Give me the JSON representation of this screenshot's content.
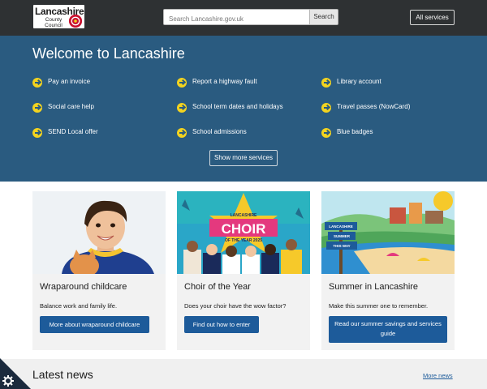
{
  "header": {
    "logo_title": "Lancashire",
    "logo_subtitle": "County Council",
    "search_placeholder": "Search Lancashire.gov.uk",
    "search_button": "Search",
    "all_services": "All services"
  },
  "hero": {
    "title": "Welcome to Lancashire",
    "services": [
      "Pay an invoice",
      "Report a highway fault",
      "Library account",
      "Social care help",
      "School term dates and holidays",
      "Travel passes (NowCard)",
      "SEND Local offer",
      "School admissions",
      "Blue badges"
    ],
    "show_more": "Show more services"
  },
  "cards": [
    {
      "title": "Wraparound childcare",
      "description": "Balance work and family life.",
      "button": "More about wraparound childcare"
    },
    {
      "title": "Choir of the Year",
      "description": "Does your choir have the wow factor?",
      "button": "Find out how to enter",
      "image_text_small": "LANCASHIRE",
      "image_text_big": "CHOIR",
      "image_text_ribbon": "OF THE YEAR 2025"
    },
    {
      "title": "Summer in Lancashire",
      "description": "Make this summer one to remember.",
      "button": "Read our summer savings and services guide",
      "sign_1": "LANCASHIRE",
      "sign_2": "SUMMER",
      "sign_3": "THIS WAY"
    }
  ],
  "news": {
    "title": "Latest news",
    "more": "More news"
  },
  "colors": {
    "header_bg": "#2e3133",
    "hero_bg": "#2a5b80",
    "accent_yellow": "#f3d31f",
    "button_blue": "#1d5b9a"
  },
  "icons": [
    "rose-icon",
    "arrow-circle-icon",
    "settings-gear-icon"
  ]
}
